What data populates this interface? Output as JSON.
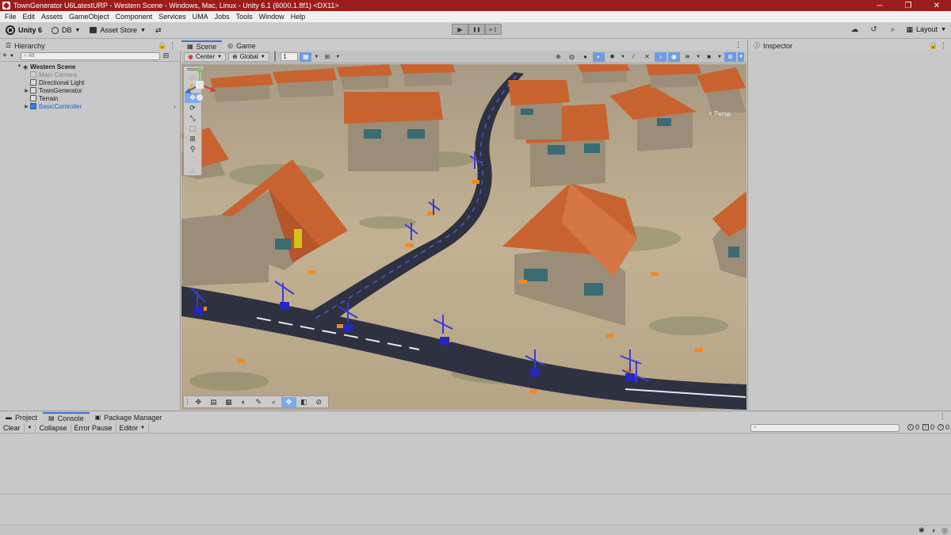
{
  "window": {
    "title": "TownGenerator U6LatestURP - Western Scene - Windows, Mac, Linux - Unity 6.1 (6000.1.8f1) <DX11>",
    "minimize": "─",
    "maximize": "❐",
    "close": "✕"
  },
  "menu": [
    "File",
    "Edit",
    "Assets",
    "GameObject",
    "Component",
    "Services",
    "UMA",
    "Jobs",
    "Tools",
    "Window",
    "Help"
  ],
  "toolbar": {
    "unity_label": "Unity 6",
    "account_label": "DB",
    "asset_store_label": "Asset Store",
    "layout_label": "Layout",
    "play_icon": "▶",
    "pause_icon": "❚❚",
    "step_icon": "▶❚"
  },
  "hierarchy": {
    "tab_label": "Hierarchy",
    "add_label": "+",
    "search_placeholder": "All",
    "items": [
      {
        "label": "Western Scene",
        "type": "scene"
      },
      {
        "label": "Main Camera",
        "type": "disabled"
      },
      {
        "label": "Directional Light",
        "type": "normal"
      },
      {
        "label": "TownGenerator",
        "type": "normal"
      },
      {
        "label": "Terrain",
        "type": "normal"
      },
      {
        "label": "BasicController",
        "type": "prefab"
      }
    ]
  },
  "scene": {
    "tabs": [
      {
        "label": "Scene",
        "icon": "grid-icon"
      },
      {
        "label": "Game",
        "icon": "gamepad-icon"
      }
    ],
    "pivot_label": "Center",
    "space_label": "Global",
    "grid_value": "1",
    "persp_label": "< Persp",
    "colors": {
      "roof": "#c8632f",
      "wall": "#9b8d78",
      "road": "#2e3140",
      "ground": "#b9a88b",
      "tool_highlight": "#7fa9e8"
    }
  },
  "inspector": {
    "tab_label": "Inspector"
  },
  "console": {
    "tabs": [
      {
        "label": "Project",
        "icon": "folder-icon"
      },
      {
        "label": "Console",
        "icon": "console-icon"
      },
      {
        "label": "Package Manager",
        "icon": "package-icon"
      }
    ],
    "buttons": {
      "clear": "Clear",
      "collapse": "Collapse",
      "error_pause": "Error Pause",
      "editor": "Editor"
    },
    "search_placeholder": "",
    "counts": {
      "info": "0",
      "warnings": "0",
      "errors": "0"
    }
  }
}
